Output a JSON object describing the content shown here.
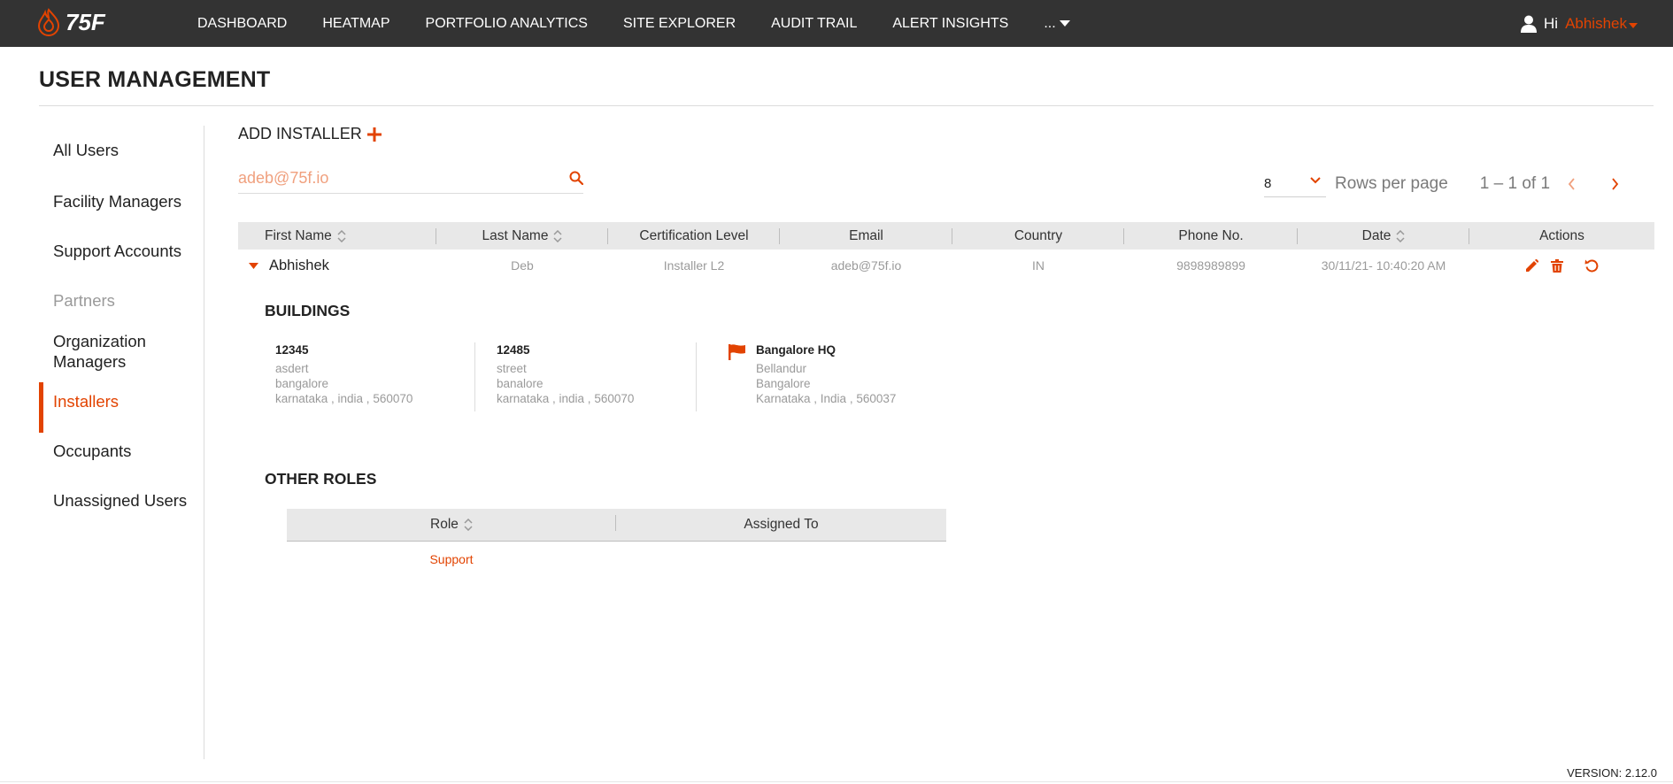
{
  "brand": {
    "logo_text": "75F",
    "accent": "#e24301"
  },
  "nav": {
    "items": [
      "DASHBOARD",
      "HEATMAP",
      "PORTFOLIO ANALYTICS",
      "SITE EXPLORER",
      "AUDIT TRAIL",
      "ALERT INSIGHTS"
    ],
    "more_label": "..."
  },
  "user": {
    "greeting": "Hi",
    "name": "Abhishek"
  },
  "page": {
    "title": "USER MANAGEMENT"
  },
  "sidebar": {
    "items": [
      {
        "label": "All Users"
      },
      {
        "label": "Facility Managers"
      },
      {
        "label": "Support Accounts"
      },
      {
        "label": "Partners"
      },
      {
        "label": "Organization Managers"
      },
      {
        "label": "Installers"
      },
      {
        "label": "Occupants"
      },
      {
        "label": "Unassigned Users"
      }
    ],
    "active": "Installers"
  },
  "main": {
    "add_label": "ADD INSTALLER",
    "search": {
      "value": "adeb@75f.io",
      "placeholder": ""
    },
    "pagination": {
      "rows_value": "8",
      "rows_label": "Rows per page",
      "range": "1 – 1 of 1"
    },
    "table": {
      "columns": [
        "First Name",
        "Last Name",
        "Certification Level",
        "Email",
        "Country",
        "Phone No.",
        "Date",
        "Actions"
      ],
      "rows": [
        {
          "first_name": "Abhishek",
          "last_name": "Deb",
          "certification": "Installer L2",
          "email": "adeb@75f.io",
          "country": "IN",
          "phone": "9898989899",
          "date": "30/11/21- 10:40:20 AM"
        }
      ]
    },
    "buildings": {
      "title": "BUILDINGS",
      "items": [
        {
          "id": "12345",
          "line1": "asdert",
          "line2": "bangalore",
          "line3": "karnataka , india , 560070"
        },
        {
          "id": "12485",
          "line1": "street",
          "line2": "banalore",
          "line3": "karnataka , india , 560070"
        },
        {
          "id": "Bangalore HQ",
          "line1": "Bellandur",
          "line2": "Bangalore",
          "line3": "Karnataka , India , 560037"
        }
      ]
    },
    "other_roles": {
      "title": "OTHER ROLES",
      "columns": [
        "Role",
        "Assigned To"
      ],
      "rows": [
        {
          "role": "Support",
          "assigned_to": ""
        }
      ]
    }
  },
  "footer": {
    "version": "VERSION: 2.12.0"
  }
}
